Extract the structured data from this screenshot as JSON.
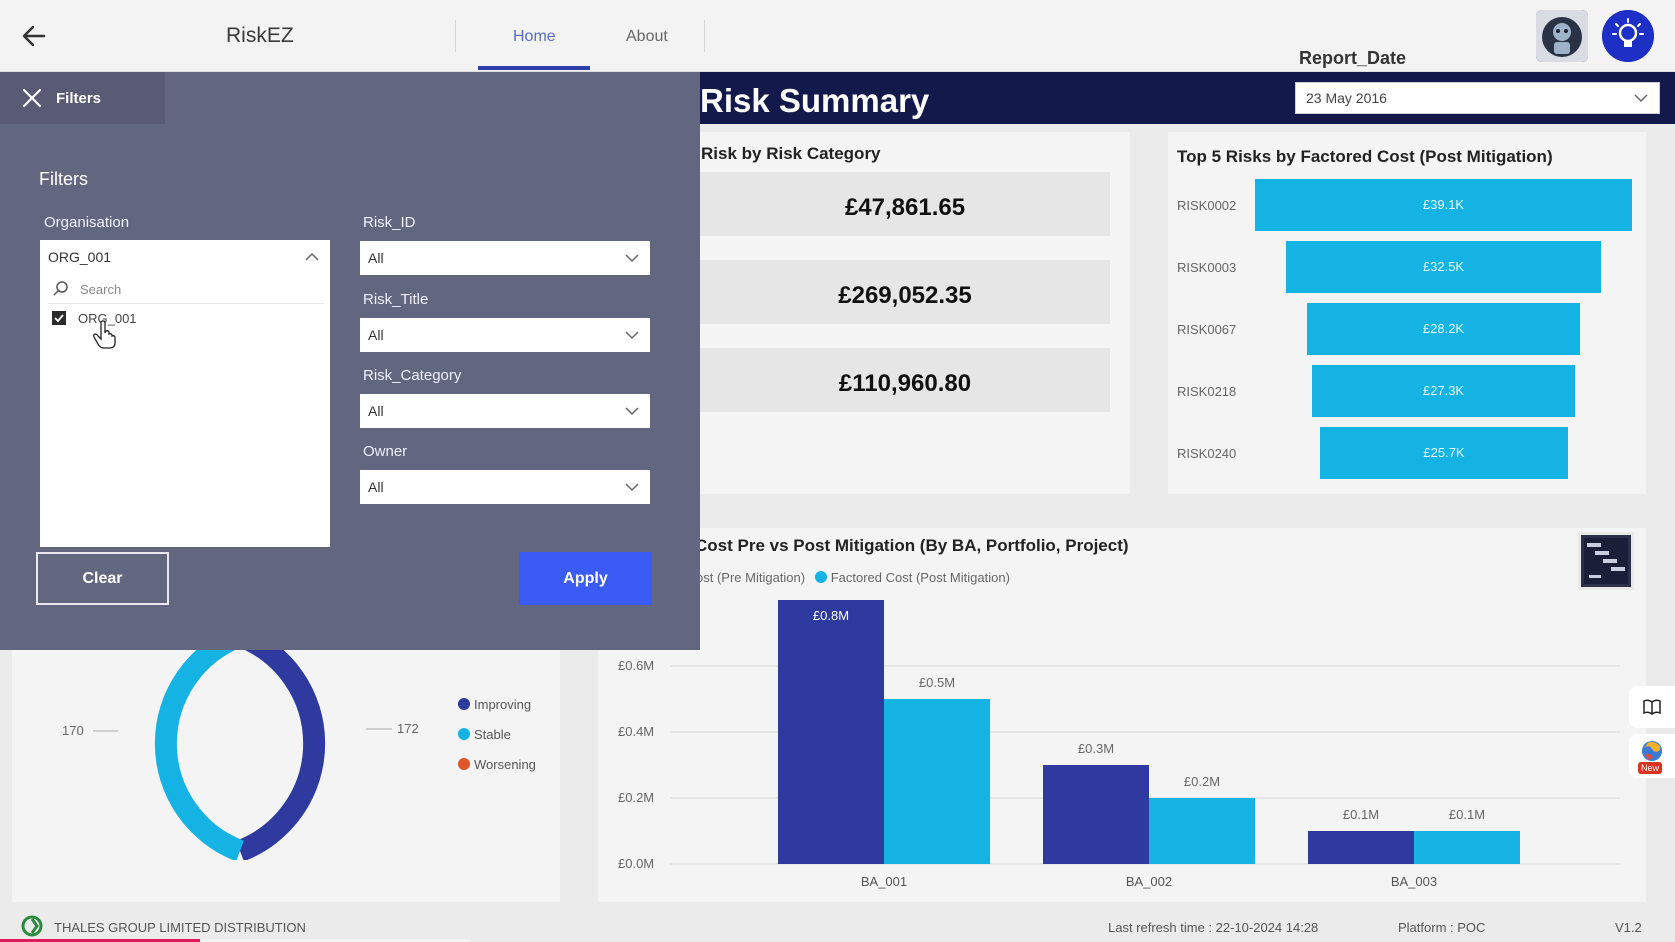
{
  "app": {
    "title": "RiskEZ",
    "nav_tabs": [
      "Home",
      "About"
    ],
    "page_title": "Risk Summary",
    "report_date_label": "Report_Date",
    "report_date_value": "23 May 2016"
  },
  "risk_by_category": {
    "title": "Risk by Risk Category",
    "values": [
      "£47,861.65",
      "£269,052.35",
      "£110,960.80"
    ]
  },
  "top5": {
    "title": "Top 5 Risks by Factored Cost (Post Mitigation)",
    "rows": [
      {
        "label": "RISK0002",
        "value": "£39.1K"
      },
      {
        "label": "RISK0003",
        "value": "£32.5K"
      },
      {
        "label": "RISK0067",
        "value": "£28.2K"
      },
      {
        "label": "RISK0218",
        "value": "£27.3K"
      },
      {
        "label": "RISK0240",
        "value": "£25.7K"
      }
    ]
  },
  "cost_chart": {
    "title": "Cost Pre vs Post Mitigation (By BA, Portfolio, Project)",
    "legend": [
      "ost (Pre Mitigation)",
      "Factored Cost (Post Mitigation)"
    ]
  },
  "trend": {
    "left_label": "170",
    "right_label": "172",
    "legend": [
      "Improving",
      "Stable",
      "Worsening"
    ]
  },
  "filters": {
    "tab_label": "Filters",
    "heading": "Filters",
    "organisation_label": "Organisation",
    "organisation_value": "ORG_001",
    "search_placeholder": "Search",
    "org_option": "ORG_001",
    "risk_id_label": "Risk_ID",
    "risk_id_value": "All",
    "risk_title_label": "Risk_Title",
    "risk_title_value": "All",
    "risk_category_label": "Risk_Category",
    "risk_category_value": "All",
    "owner_label": "Owner",
    "owner_value": "All",
    "clear_label": "Clear",
    "apply_label": "Apply"
  },
  "footer": {
    "distribution": "THALES GROUP LIMITED DISTRIBUTION",
    "refresh": "Last refresh time : 22-10-2024 14:28",
    "platform": "Platform : POC",
    "version": "V1.2"
  },
  "side": {
    "new_badge": "New"
  },
  "colors": {
    "navy": "#131a4b",
    "pre_mitigation": "#2e3a9e",
    "post_mitigation": "#15b3e3",
    "worsening": "#e0542a",
    "apply": "#3b5bf5",
    "panel": "#63667f"
  },
  "chart_data": {
    "type": "bar",
    "title": "Cost Pre vs Post Mitigation (By BA, Portfolio, Project)",
    "categories": [
      "BA_001",
      "BA_002",
      "BA_003"
    ],
    "series": [
      {
        "name": "Cost (Pre Mitigation)",
        "values": [
          0.8,
          0.3,
          0.1
        ],
        "labels": [
          "£0.8M",
          "£0.3M",
          "£0.1M"
        ]
      },
      {
        "name": "Factored Cost (Post Mitigation)",
        "values": [
          0.5,
          0.2,
          0.1
        ],
        "labels": [
          "£0.5M",
          "£0.2M",
          "£0.1M"
        ]
      }
    ],
    "yticks": [
      "£0.0M",
      "£0.2M",
      "£0.4M",
      "£0.6M"
    ],
    "ylim": [
      0,
      0.8
    ],
    "grid": true,
    "legend": "top-left"
  }
}
